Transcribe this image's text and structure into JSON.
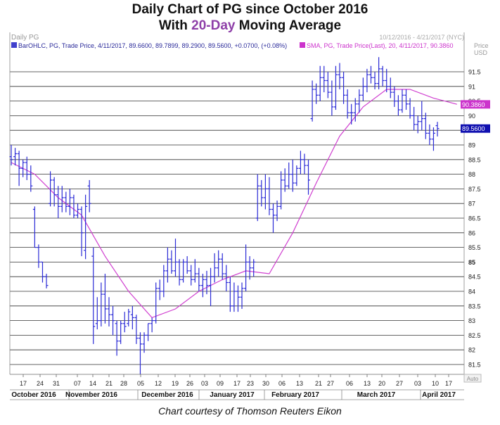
{
  "title": {
    "line1": "Daily Chart of PG since October 2016",
    "line2_prefix": "With ",
    "line2_highlight": "20-Day",
    "line2_suffix": " Moving Average"
  },
  "header": {
    "symbol_label": "Daily PG",
    "date_range": "10/12/2016 - 4/21/2017 (NYC)",
    "price_label": "Price",
    "currency_label": "USD",
    "legend_bar": "BarOHLC, PG, Trade Price, 4/11/2017, 89.6600, 89.7899, 89.2900, 89.5600, +0.0700, (+0.08%)",
    "legend_sma": "SMA, PG, Trade Price(Last), 20, 4/11/2017, 90.3860",
    "auto_label": "Auto"
  },
  "price_tags": {
    "sma_value": "90.3860",
    "last_value": "89.5600"
  },
  "caption": "Chart courtesy of Thomson Reuters Eikon",
  "colors": {
    "bars": "#2b2bd6",
    "sma": "#d040d0",
    "sma_tag": "#cc33cc",
    "last_tag": "#1010b0",
    "title_highlight": "#8e3fa8",
    "grid": "#333333",
    "legend_text": "#2a2a9a",
    "legend_sma_text": "#cc33cc"
  },
  "chart_data": {
    "type": "ohlc_bar",
    "title": "Daily Chart of PG since October 2016 With 20-Day Moving Average",
    "x_range": [
      "2016-10-12",
      "2017-04-21"
    ],
    "ylim": [
      81,
      92.25
    ],
    "y_ticks": [
      "81.5",
      "82",
      "82.5",
      "83",
      "83.5",
      "84",
      "84.5",
      "85",
      "85.5",
      "86",
      "86.5",
      "87",
      "87.5",
      "88",
      "88.5",
      "89",
      "89.5",
      "90",
      "90.5",
      "91",
      "91.5"
    ],
    "x_day_ticks": [
      "17",
      "24",
      "31",
      "07",
      "14",
      "21",
      "28",
      "05",
      "12",
      "19",
      "26",
      "03",
      "09",
      "17",
      "23",
      "30",
      "06",
      "13",
      "21",
      "27",
      "06",
      "13",
      "20",
      "27",
      "03",
      "10",
      "17"
    ],
    "x_month_labels": [
      "October 2016",
      "November 2016",
      "December 2016",
      "January 2017",
      "February 2017",
      "March 2017",
      "April 2017"
    ],
    "grid": true,
    "series": [
      {
        "name": "BarOHLC, PG, Trade Price",
        "ohlc": [
          [
            88.6,
            89.0,
            88.3,
            88.5
          ],
          [
            88.6,
            88.9,
            88.3,
            88.7
          ],
          [
            88.7,
            88.8,
            87.6,
            88.2
          ],
          [
            88.2,
            88.5,
            87.9,
            88.4
          ],
          [
            88.4,
            88.6,
            87.8,
            88.0
          ],
          [
            88.0,
            88.3,
            87.4,
            87.6
          ],
          [
            86.8,
            86.9,
            85.5,
            85.5
          ],
          [
            85.5,
            85.6,
            84.8,
            85.0
          ],
          [
            85.0,
            85.0,
            84.3,
            84.5
          ],
          [
            84.5,
            84.6,
            84.1,
            84.2
          ],
          [
            87.0,
            88.1,
            86.9,
            87.8
          ],
          [
            87.8,
            87.9,
            86.9,
            87.3
          ],
          [
            87.3,
            87.6,
            86.5,
            86.9
          ],
          [
            86.9,
            87.6,
            86.7,
            87.2
          ],
          [
            87.2,
            87.4,
            86.7,
            86.9
          ],
          [
            86.9,
            87.5,
            86.6,
            87.2
          ],
          [
            87.2,
            87.3,
            86.5,
            86.6
          ],
          [
            86.6,
            87.0,
            86.5,
            86.8
          ],
          [
            86.8,
            86.9,
            85.2,
            86.0
          ],
          [
            85.4,
            87.3,
            85.1,
            86.9
          ],
          [
            87.6,
            87.8,
            86.7,
            87.0
          ],
          [
            85.2,
            85.5,
            82.2,
            82.8
          ],
          [
            82.9,
            83.8,
            82.7,
            83.0
          ],
          [
            83.0,
            84.3,
            82.8,
            83.9
          ],
          [
            83.9,
            84.6,
            82.9,
            83.4
          ],
          [
            83.4,
            83.8,
            82.8,
            83.2
          ],
          [
            83.2,
            83.5,
            82.5,
            83.0
          ],
          [
            82.9,
            83.0,
            81.8,
            82.3
          ],
          [
            82.3,
            83.0,
            82.2,
            82.9
          ],
          [
            82.9,
            83.3,
            82.6,
            82.8
          ],
          [
            82.9,
            83.4,
            82.8,
            83.3
          ],
          [
            83.2,
            83.5,
            82.7,
            83.1
          ],
          [
            83.1,
            83.2,
            82.2,
            82.4
          ],
          [
            82.4,
            82.6,
            81.1,
            82.2
          ],
          [
            82.2,
            82.6,
            81.9,
            82.5
          ],
          [
            82.5,
            82.9,
            82.3,
            82.9
          ],
          [
            82.9,
            83.1,
            82.6,
            83.0
          ],
          [
            83.0,
            84.3,
            82.9,
            84.1
          ],
          [
            84.1,
            84.4,
            83.7,
            84.0
          ],
          [
            84.0,
            84.9,
            83.8,
            84.7
          ],
          [
            84.7,
            85.5,
            84.3,
            85.1
          ],
          [
            85.1,
            85.4,
            84.6,
            84.7
          ],
          [
            84.7,
            85.8,
            84.5,
            85.0
          ],
          [
            85.0,
            85.1,
            84.2,
            84.4
          ],
          [
            84.4,
            85.1,
            84.3,
            85.0
          ],
          [
            85.0,
            85.2,
            84.6,
            84.7
          ],
          [
            84.7,
            84.9,
            84.2,
            84.4
          ],
          [
            84.4,
            85.1,
            84.3,
            84.6
          ],
          [
            84.6,
            84.8,
            84.0,
            84.2
          ],
          [
            84.2,
            84.6,
            83.8,
            84.4
          ],
          [
            84.4,
            84.7,
            83.9,
            84.2
          ],
          [
            84.2,
            84.8,
            83.5,
            84.5
          ],
          [
            84.5,
            85.3,
            84.3,
            84.8
          ],
          [
            84.8,
            85.4,
            84.5,
            85.1
          ],
          [
            85.1,
            85.3,
            84.4,
            84.6
          ],
          [
            84.6,
            84.9,
            84.0,
            84.3
          ],
          [
            84.3,
            84.5,
            83.3,
            83.5
          ],
          [
            83.5,
            84.3,
            83.3,
            84.0
          ],
          [
            84.0,
            84.2,
            83.3,
            83.8
          ],
          [
            83.8,
            84.3,
            83.4,
            84.1
          ],
          [
            84.1,
            85.6,
            84.0,
            85.0
          ],
          [
            85.0,
            85.2,
            84.4,
            84.8
          ],
          [
            84.8,
            85.1,
            84.5,
            85.0
          ],
          [
            86.5,
            88.0,
            86.4,
            87.6
          ],
          [
            87.6,
            87.8,
            86.9,
            87.2
          ],
          [
            87.2,
            88.0,
            86.8,
            87.5
          ],
          [
            87.5,
            87.9,
            86.6,
            86.8
          ],
          [
            86.8,
            87.0,
            86.0,
            86.6
          ],
          [
            86.6,
            87.1,
            86.4,
            86.9
          ],
          [
            86.9,
            88.1,
            86.8,
            87.8
          ],
          [
            87.8,
            88.2,
            87.4,
            87.6
          ],
          [
            87.6,
            88.4,
            87.5,
            88.0
          ],
          [
            88.0,
            88.5,
            87.4,
            87.7
          ],
          [
            87.7,
            88.3,
            87.6,
            88.2
          ],
          [
            88.2,
            88.8,
            88.0,
            88.5
          ],
          [
            88.5,
            88.7,
            88.0,
            88.3
          ],
          [
            88.3,
            88.5,
            87.3,
            87.8
          ],
          [
            89.9,
            91.2,
            89.8,
            90.9
          ],
          [
            90.9,
            91.1,
            90.4,
            90.7
          ],
          [
            90.7,
            91.7,
            90.5,
            91.3
          ],
          [
            91.3,
            91.7,
            90.8,
            91.2
          ],
          [
            91.2,
            91.5,
            90.6,
            90.8
          ],
          [
            90.8,
            91.2,
            90.0,
            90.3
          ],
          [
            90.3,
            91.7,
            90.2,
            91.4
          ],
          [
            91.4,
            91.8,
            90.9,
            91.3
          ],
          [
            91.3,
            91.5,
            90.4,
            90.7
          ],
          [
            90.7,
            90.9,
            89.9,
            90.1
          ],
          [
            90.1,
            90.4,
            89.7,
            90.1
          ],
          [
            90.1,
            90.6,
            89.8,
            90.4
          ],
          [
            90.4,
            90.9,
            90.1,
            90.7
          ],
          [
            90.7,
            91.3,
            90.5,
            91.0
          ],
          [
            91.0,
            91.6,
            90.8,
            91.4
          ],
          [
            91.4,
            91.7,
            91.1,
            91.3
          ],
          [
            91.3,
            91.5,
            90.9,
            91.1
          ],
          [
            91.1,
            92.0,
            90.9,
            91.6
          ],
          [
            91.6,
            91.7,
            91.0,
            91.2
          ],
          [
            91.2,
            91.6,
            90.8,
            91.0
          ],
          [
            91.0,
            91.3,
            90.6,
            90.8
          ],
          [
            90.8,
            91.0,
            90.3,
            90.5
          ],
          [
            90.5,
            90.7,
            90.0,
            90.2
          ],
          [
            90.2,
            90.9,
            90.1,
            90.7
          ],
          [
            90.7,
            90.9,
            90.2,
            90.4
          ],
          [
            90.4,
            90.6,
            89.9,
            90.0
          ],
          [
            90.0,
            90.3,
            89.5,
            89.7
          ],
          [
            89.7,
            90.0,
            89.4,
            89.8
          ],
          [
            89.8,
            90.5,
            89.5,
            89.9
          ],
          [
            89.9,
            90.1,
            89.2,
            89.4
          ],
          [
            89.4,
            89.7,
            89.0,
            89.2
          ],
          [
            89.2,
            89.6,
            88.8,
            89.4
          ],
          [
            89.66,
            89.79,
            89.29,
            89.56
          ]
        ]
      },
      {
        "name": "SMA, PG, Trade Price(Last), 20",
        "x_index": [
          0,
          6,
          12,
          18,
          24,
          30,
          36,
          42,
          48,
          54,
          60,
          66,
          72,
          78,
          84,
          90,
          96,
          102,
          108,
          114
        ],
        "values": [
          88.4,
          88.0,
          87.2,
          86.6,
          85.2,
          84.0,
          83.1,
          83.4,
          84.0,
          84.4,
          84.7,
          84.6,
          86.0,
          87.7,
          89.3,
          90.3,
          90.9,
          90.9,
          90.6,
          90.39
        ]
      }
    ]
  }
}
